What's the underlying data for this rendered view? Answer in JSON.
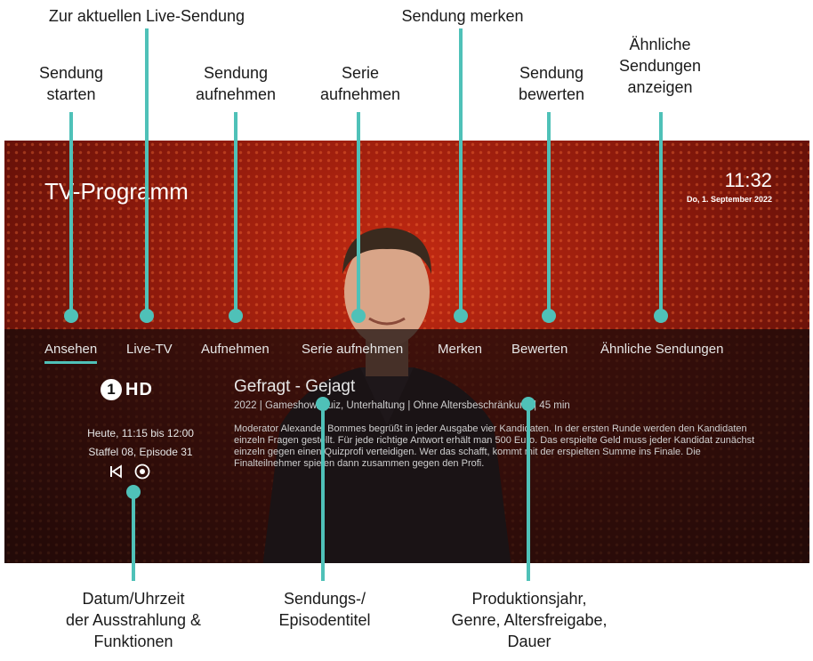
{
  "callouts": {
    "zur_live": "Zur aktuellen Live-Sendung",
    "merken": "Sendung merken",
    "aehnliche": "Ähnliche\nSendungen\nanzeigen",
    "starten": "Sendung\nstarten",
    "aufnehmen": "Sendung\naufnehmen",
    "serie": "Serie\naufnehmen",
    "bewerten": "Sendung\nbewerten",
    "datum": "Datum/Uhrzeit\nder Ausstrahlung &\nFunktionen",
    "titel": "Sendungs-/\nEpisodentitel",
    "produktion": "Produktionsjahr,\nGenre, Altersfreigabe,\nDauer"
  },
  "tv": {
    "title": "TV-Programm",
    "time": "11:32",
    "date": "Do, 1. September 2022",
    "menu": [
      "Ansehen",
      "Live-TV",
      "Aufnehmen",
      "Serie aufnehmen",
      "Merken",
      "Bewerten",
      "Ähnliche Sendungen"
    ],
    "active_menu": "Ansehen",
    "channel": {
      "number": "1",
      "suffix": "HD"
    },
    "airtime": "Heute, 11:15 bis 12:00",
    "episode": "Staffel 08, Episode 31",
    "controls": {
      "restart_icon": "restart-icon",
      "record_icon": "record-icon"
    },
    "show_title": "Gefragt - Gejagt",
    "meta": "2022  |  Gameshow/Quiz, Unterhaltung  |  Ohne Altersbeschränkung  |  45 min",
    "description": "Moderator Alexander Bommes begrüßt in jeder Ausgabe vier Kandidaten. In der ersten Runde werden den Kandidaten einzeln Fragen gestellt. Für jede richtige Antwort erhält man 500 Euro. Das erspielte Geld muss jeder Kandidat zunächst einzeln gegen einen Quizprofi verteidigen. Wer das schafft, kommt mit der erspielten Summe ins Finale. Die Finalteilnehmer spielen dann zusammen gegen den Profi."
  },
  "colors": {
    "accent": "#4fc1b8",
    "tv_red": "#8e1a0c"
  }
}
